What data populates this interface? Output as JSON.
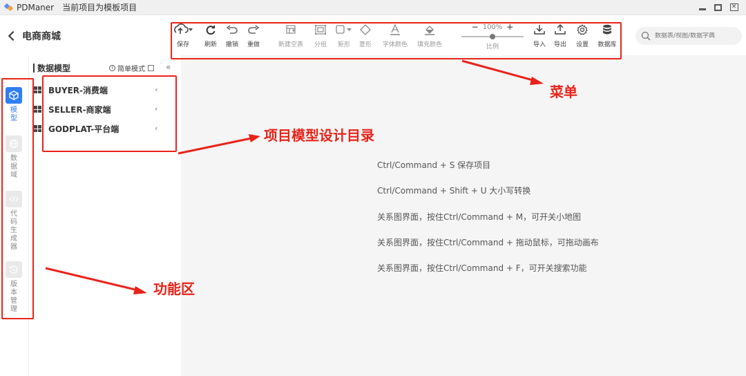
{
  "window": {
    "app_name": "PDManer",
    "project_info": "当前项目为模板项目"
  },
  "header": {
    "project_name": "电商商城"
  },
  "toolbar": {
    "save": "保存",
    "refresh": "刷新",
    "undo": "撤销",
    "redo": "重做",
    "new_table": "新建空表",
    "group": "分组",
    "rect": "矩形",
    "diamond": "菱形",
    "font_color": "字体颜色",
    "fill_color": "填充颜色",
    "zoom_value": "100%",
    "zoom_label": "比例",
    "import": "导入",
    "export": "导出",
    "settings": "设置",
    "database": "数据库"
  },
  "search": {
    "placeholder": "数据表/视图/数据字典"
  },
  "funcbar": {
    "items": [
      {
        "label": "模型",
        "icon": "cube-icon",
        "active": true
      },
      {
        "label": "数据域",
        "icon": "globe-icon",
        "active": false
      },
      {
        "label": "代码生成器",
        "icon": "code-icon",
        "active": false
      },
      {
        "label": "版本管理",
        "icon": "history-icon",
        "active": false
      }
    ]
  },
  "tree": {
    "title": "数据模型",
    "simple_mode": "简单模式",
    "items": [
      {
        "label": "BUYER-消费端"
      },
      {
        "label": "SELLER-商家端"
      },
      {
        "label": "GODPLAT-平台端"
      }
    ]
  },
  "canvas": {
    "hints": [
      "Ctrl/Command + S 保存项目",
      "Ctrl/Command + Shift + U 大小写转换",
      "关系图界面，按住Ctrl/Command + M，可开关小地图",
      "关系图界面，按住Ctrl/Command + 拖动鼠标，可拖动画布",
      "关系图界面，按住Ctrl/Command + F，可开关搜索功能"
    ]
  },
  "annotations": {
    "menu": "菜单",
    "tree_dir": "项目模型设计目录",
    "func_area": "功能区",
    "color": "#e8231a"
  },
  "colors": {
    "accent": "#2f7ef2"
  }
}
